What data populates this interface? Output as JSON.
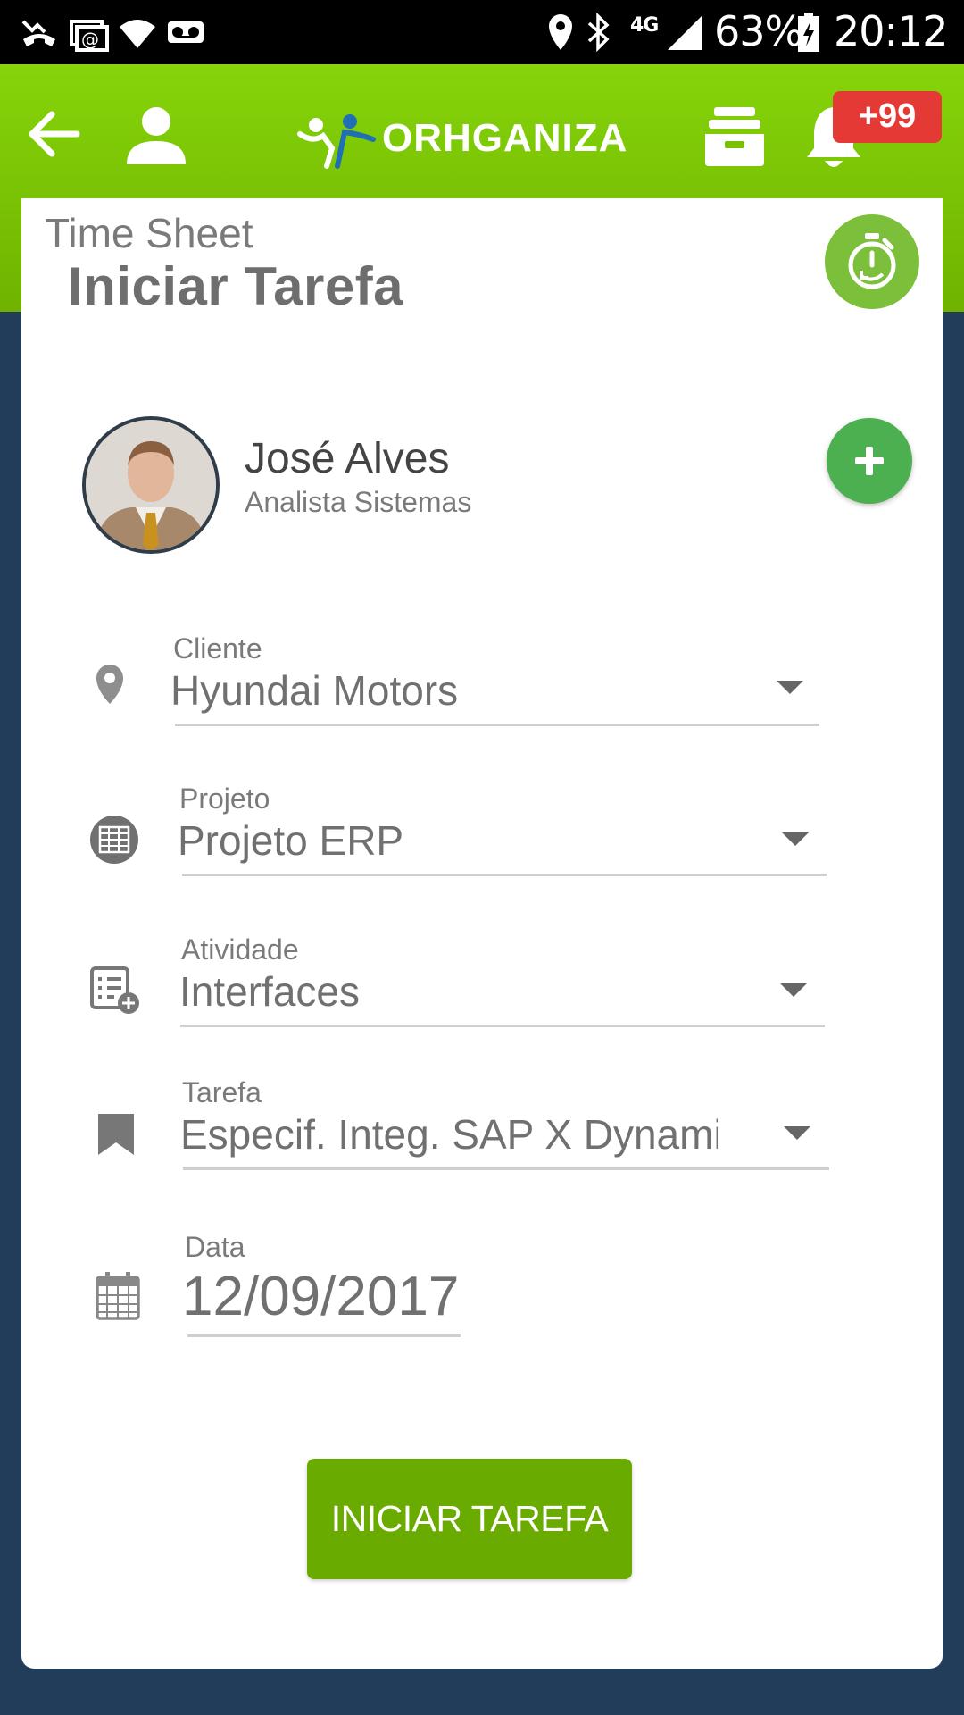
{
  "status_bar": {
    "battery": "63%",
    "time": "20:12",
    "network": "4G",
    "icons": [
      "missed-call-icon",
      "email-icon",
      "wifi-icon",
      "voicemail-icon",
      "location-icon",
      "bluetooth-icon",
      "signal-icon",
      "battery-icon"
    ]
  },
  "header": {
    "logo_text": "ORHGANIZA",
    "notification_count": "+99",
    "icons": [
      "back-arrow-icon",
      "profile-icon",
      "inbox-icon",
      "bell-icon"
    ]
  },
  "page": {
    "breadcrumb": "Time Sheet",
    "title": "Iniciar Tarefa"
  },
  "user": {
    "name": "José Alves",
    "role": "Analista Sistemas"
  },
  "form": {
    "cliente": {
      "label": "Cliente",
      "value": "Hyundai Motors",
      "icon": "location-pin-icon"
    },
    "projeto": {
      "label": "Projeto",
      "value": "Projeto ERP",
      "icon": "project-icon"
    },
    "atividade": {
      "label": "Atividade",
      "value": "Interfaces",
      "icon": "activity-list-icon"
    },
    "tarefa": {
      "label": "Tarefa",
      "value": "Especif. Integ. SAP X Dynamics",
      "icon": "bookmark-icon"
    },
    "data": {
      "label": "Data",
      "value": "12/09/2017",
      "icon": "calendar-icon"
    }
  },
  "actions": {
    "start_label": "INICIAR TAREFA"
  },
  "colors": {
    "header_green": "#7cc700",
    "button_green": "#6aab00",
    "add_button": "#4caf50",
    "badge_red": "#e53935",
    "background": "#223d5a"
  }
}
